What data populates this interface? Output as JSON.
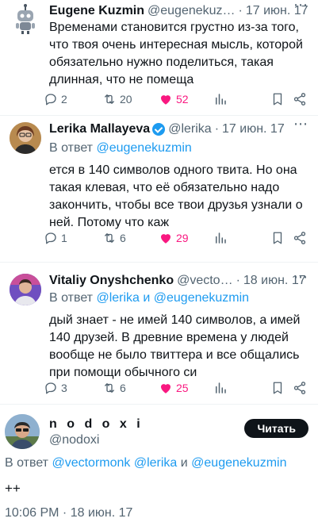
{
  "tweets": [
    {
      "name": "Eugene Kuzmin",
      "handle": "@eugenekuz…",
      "time": "17 июн. 17",
      "reply_prefix": "",
      "reply_users": "",
      "text_lines": [
        "Временами становится грустно из-за того,",
        "что твоя очень интересная мысль, которой",
        "обязательно нужно поделиться, такая",
        "длинная, что не помеща"
      ],
      "replies": "2",
      "retweets": "20",
      "likes": "52"
    },
    {
      "name": "Lerika Mallayeva",
      "handle": "@lerika",
      "time": "17 июн. 17",
      "reply_prefix": "В ответ ",
      "reply_users": "@eugenekuzmin",
      "text_lines": [
        "ется в 140 символов одного твита. Но она",
        "такая клевая, что её обязательно надо",
        "закончить, чтобы все твои друзья узнали о",
        "ней. Потому что каж"
      ],
      "replies": "1",
      "retweets": "6",
      "likes": "29"
    },
    {
      "name": "Vitaliy Onyshchenko",
      "handle": "@vecto…",
      "time": "18 июн. 17",
      "reply_prefix": "В ответ ",
      "reply_users": "@lerika и @eugenekuzmin",
      "text_lines": [
        "дый знает - не имей 140 символов, а имей",
        "140 друзей. В древние времена у людей",
        "вообще не было твиттера и все общались",
        "при помощи обычного си"
      ],
      "replies": "3",
      "retweets": "6",
      "likes": "25"
    }
  ],
  "main": {
    "name": "n o d o x i",
    "handle": "@nodoxi",
    "follow_label": "Читать",
    "reply_prefix": "В ответ ",
    "reply_user1": "@vectormonk",
    "reply_user2": "@lerika",
    "reply_and": " и ",
    "reply_user3": "@eugenekuzmin",
    "text": "++",
    "timestamp": "10:06 PM · 18 июн. 17"
  },
  "colors": {
    "accent": "#1d9bf0",
    "like": "#f91880",
    "muted": "#536471"
  }
}
